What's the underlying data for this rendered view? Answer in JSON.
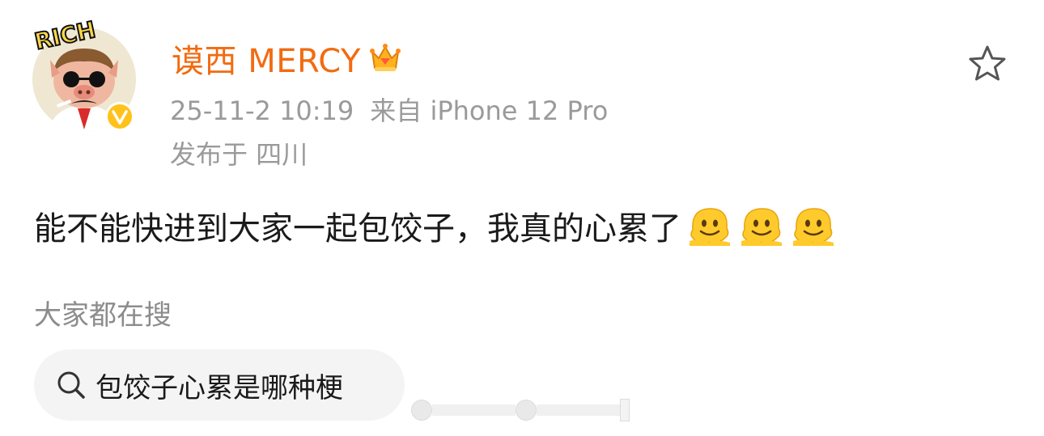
{
  "post": {
    "username": "谟西 MERCY",
    "timestamp": "25-11-2 10:19",
    "source": "来自 iPhone 12 Pro",
    "location": "发布于 四川",
    "text": "能不能快进到大家一起包饺子，我真的心累了",
    "emojis": [
      "melting-face-emoji",
      "melting-face-emoji",
      "melting-face-emoji"
    ],
    "avatar_text": "RICH"
  },
  "icons": {
    "favorite": "star-outline-icon",
    "member": "crown-icon",
    "verified": "verified-v-icon",
    "search": "search-icon"
  },
  "trending": {
    "title": "大家都在搜",
    "query": "包饺子心累是哪种梗"
  },
  "colors": {
    "username": "#f26b11",
    "meta_text": "#9a9a9a",
    "body_text": "#1a1a1a",
    "pill_bg": "#f4f4f4",
    "verified_badge": "#ffc21a"
  }
}
